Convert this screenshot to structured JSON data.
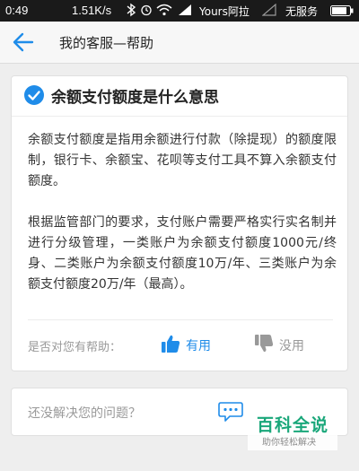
{
  "status_bar": {
    "time": "0:49",
    "speed": "1.51K/s",
    "carrier1": "Yours阿拉",
    "carrier2": "无服务"
  },
  "nav": {
    "title": "我的客服—帮助"
  },
  "article": {
    "title": "余额支付额度是什么意思",
    "paragraphs": [
      "余额支付额度是指用余额进行付款（除提现）的额度限制，银行卡、余额宝、花呗等支付工具不算入余额支付额度。",
      "根据监管部门的要求，支付账户需要严格实行实名制并进行分级管理，一类账户为余额支付额度1000元/终身、二类账户为余额支付额度10万/年、三类账户为余额支付额度20万/年（最高）。"
    ],
    "helpful_question": "是否对您有帮助：",
    "yes_label": "有用",
    "no_label": "没用"
  },
  "unresolved": {
    "question": "还没解决您的问题？"
  },
  "watermark": {
    "title": "百科全说",
    "subtitle": "助你轻松解决"
  },
  "icons": {
    "back": "arrow-left-icon",
    "check": "check-circle-icon",
    "thumbs_up": "thumbs-up-icon",
    "thumbs_down": "thumbs-down-icon",
    "chat": "chat-bubble-icon"
  },
  "colors": {
    "accent": "#1f8ce9",
    "status_bar": "#1a1a1a",
    "watermark": "#1aa77a"
  }
}
